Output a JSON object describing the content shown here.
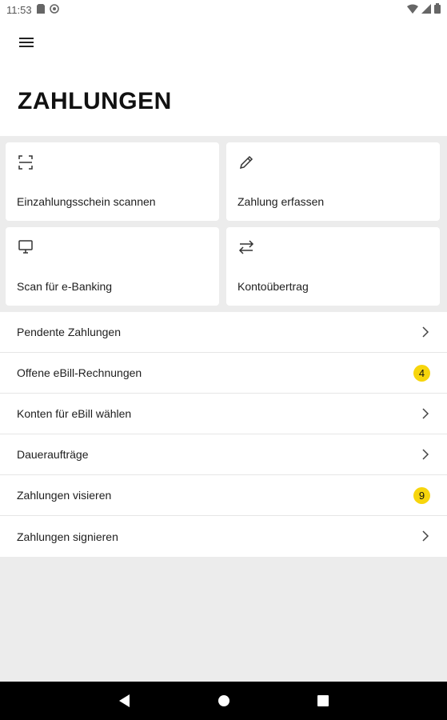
{
  "status_bar": {
    "time": "11:53",
    "icons": [
      "sd-card-icon",
      "sync-icon",
      "wifi-icon",
      "signal-icon",
      "battery-icon"
    ]
  },
  "header": {
    "menu_icon": "hamburger-menu-icon",
    "title": "ZAHLUNGEN"
  },
  "tiles": [
    {
      "label": "Einzahlungsschein scannen",
      "icon": "scan-icon"
    },
    {
      "label": "Zahlung erfassen",
      "icon": "pencil-icon"
    },
    {
      "label": "Scan für e-Banking",
      "icon": "monitor-icon"
    },
    {
      "label": "Kontoübertrag",
      "icon": "transfer-icon"
    }
  ],
  "list": [
    {
      "label": "Pendente Zahlungen",
      "badge": null
    },
    {
      "label": "Offene eBill-Rechnungen",
      "badge": "4"
    },
    {
      "label": "Konten für eBill wählen",
      "badge": null
    },
    {
      "label": "Daueraufträge",
      "badge": null
    },
    {
      "label": "Zahlungen visieren",
      "badge": "9"
    },
    {
      "label": "Zahlungen signieren",
      "badge": null
    }
  ],
  "colors": {
    "badge": "#f7d50c",
    "background": "#ececec",
    "card": "#ffffff",
    "navbar": "#000000"
  },
  "nav_bar": {
    "icons": [
      "back-icon",
      "home-icon",
      "recents-icon"
    ]
  }
}
